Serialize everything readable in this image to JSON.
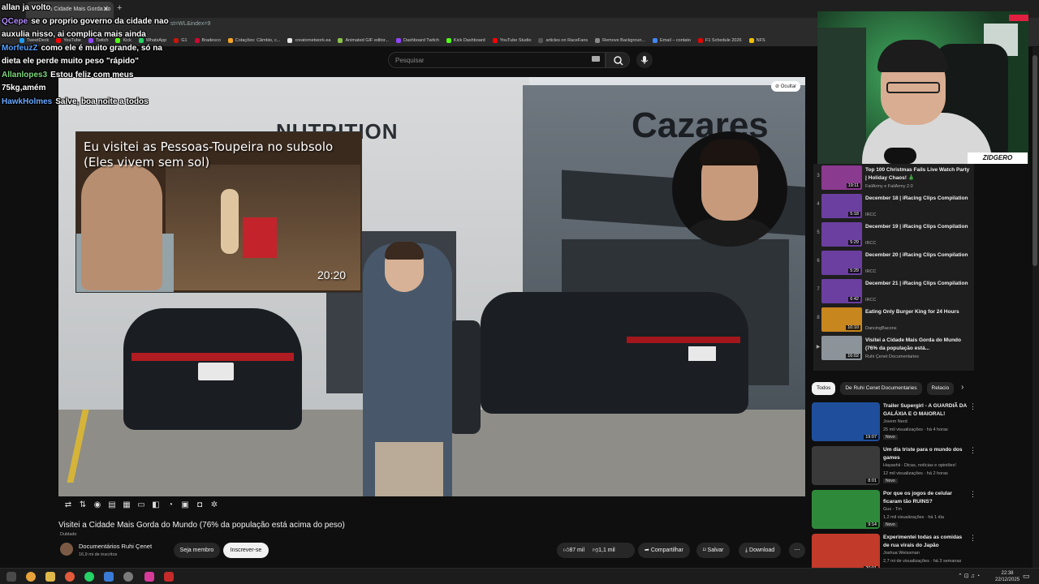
{
  "browser": {
    "tab_title": "Visitei a Cidade Mais Gorda do",
    "url": "st=WL&index=9",
    "bookmarks": [
      {
        "label": "TweetDeck",
        "color": "#1d9bf0"
      },
      {
        "label": "YouTube",
        "color": "#ff0000"
      },
      {
        "label": "Twitch",
        "color": "#9146ff"
      },
      {
        "label": "Kick",
        "color": "#53fc18"
      },
      {
        "label": "WhatsApp",
        "color": "#25d366"
      },
      {
        "label": "G1",
        "color": "#c4170c"
      },
      {
        "label": "Bradesco",
        "color": "#cc092f"
      },
      {
        "label": "Cotações: Câmbio, c...",
        "color": "#f5a623"
      },
      {
        "label": "creatornetwork.ea",
        "color": "#e8e8e8"
      },
      {
        "label": "Animated GIF editor...",
        "color": "#8bc34a"
      },
      {
        "label": "Dashboard Twitch",
        "color": "#9146ff"
      },
      {
        "label": "Kick Dashboard",
        "color": "#53fc18"
      },
      {
        "label": "YouTube Studio",
        "color": "#ff0000"
      },
      {
        "label": "articles on RaceFans",
        "color": "#555"
      },
      {
        "label": "Remove Backgroun...",
        "color": "#888"
      },
      {
        "label": "Email – contato",
        "color": "#4285f4"
      },
      {
        "label": "F1 Schedule 2026",
        "color": "#e10600"
      },
      {
        "label": "NFS",
        "color": "#f0c000"
      }
    ]
  },
  "header": {
    "search_placeholder": "Pesquisar"
  },
  "video": {
    "sign_nutrition": "NUTRITION",
    "sign_store": "Cazares",
    "hide_label": "Ocultar",
    "overlay_thumb": {
      "title": "Eu visitei as Pessoas-Toupeira no subsolo (Eles vivem sem sol)",
      "duration": "20:20"
    },
    "title": "Visitei a Cidade Mais Gorda do Mundo (76% da população está acima do peso)",
    "dubbed": "Dublado",
    "channel": "Documentários Ruhi Çenet",
    "subscribers": "16,9 mi de inscritos",
    "member_label": "Seja membro",
    "subscribe_label": "Inscrever-se",
    "likes": "87 mil",
    "dislikes": "1,1 mil",
    "share_label": "Compartilhar",
    "save_label": "Salvar",
    "download_label": "Download",
    "control_icons": [
      "loop-icon",
      "sort-icon",
      "audio-icon",
      "captions-icon",
      "chapters-icon",
      "theater-icon",
      "miniplayer-icon",
      "speed-icon",
      "transcript-icon",
      "screenshot-icon",
      "settings-icon"
    ]
  },
  "chat": [
    {
      "user": "allan ja volto",
      "color": "#ffffff",
      "message": ""
    },
    {
      "user": "QCepe",
      "color": "#b48cff",
      "message": "se o proprio governo da cidade nao auxulia nisso, ai complica mais ainda"
    },
    {
      "user": "MorfeuzZ",
      "color": "#5aa0ff",
      "message": "como ele é muito grande, só na dieta ele perde muito peso \"rápido\""
    },
    {
      "user": "Allanlopes3",
      "color": "#7dd87d",
      "message": "Estou feliz com meus 75kg,amém"
    },
    {
      "user": "HawkHolmes",
      "color": "#6aa8ff",
      "message": "Salve, boa noite a todos"
    }
  ],
  "webcam": {
    "logo": "ZIDGERO"
  },
  "playlist": [
    {
      "index": "3",
      "title": "Top 100 Christmas Fails Live Watch Party | Holiday Chaos! 🎄",
      "channel": "FailArmy e FailArmy 2.0",
      "duration": "19:11",
      "color": "#8a3a8f"
    },
    {
      "index": "4",
      "title": "December 18 | iRacing Clips Compilation",
      "channel": "IRCC",
      "duration": "5:18",
      "color": "#6b3fa0"
    },
    {
      "index": "5",
      "title": "December 19 | iRacing Clips Compilation",
      "channel": "IRCC",
      "duration": "5:29",
      "color": "#6b3fa0"
    },
    {
      "index": "6",
      "title": "December 20 | iRacing Clips Compilation",
      "channel": "IRCC",
      "duration": "5:29",
      "color": "#6b3fa0"
    },
    {
      "index": "7",
      "title": "December 21 | iRacing Clips Compilation",
      "channel": "IRCC",
      "duration": "6:42",
      "color": "#6b3fa0"
    },
    {
      "index": "8",
      "title": "Eating Only Burger King for 24 Hours",
      "channel": "DancingBacons",
      "duration": "10:10",
      "color": "#c8861e"
    },
    {
      "index": "▶",
      "title": "Visitei a Cidade Mais Gorda do Mundo (76% da população está...",
      "channel": "Ruhi Çenet Documentaries",
      "duration": "16:02",
      "color": "#8c949a"
    }
  ],
  "chips": [
    {
      "label": "Todos",
      "active": true
    },
    {
      "label": "De Ruhi Cenet Documentaries",
      "active": false
    },
    {
      "label": "Relacio",
      "active": false
    }
  ],
  "recommendations": [
    {
      "title": "Trailer Supergirl - A GUARDIÃ DA GALÁXIA E O MAIORAL!",
      "channel": "Jovem Nerd",
      "meta": "25 mil visualizações · há 4 horas",
      "badge": "Novo",
      "duration": "19:07",
      "color": "#1f4f9c"
    },
    {
      "title": "Um dia triste para o mundo dos games",
      "channel": "Hayashii - Dicas, notícias e opiniões!",
      "meta": "12 mil visualizações · há 2 horas",
      "badge": "Novo",
      "duration": "8:01",
      "color": "#3a3a3a"
    },
    {
      "title": "Por que os jogos de celular ficaram tão RUINS?",
      "channel": "Gus - Tm",
      "meta": "1,2 mil visualizações · há 1 dia",
      "badge": "Novo",
      "duration": "9:14",
      "color": "#2e8a3a"
    },
    {
      "title": "Experimentei todas as comidas de rua virais do Japão",
      "channel": "Joshua Weissman",
      "meta": "2,7 mi de visualizações · há 3 semanas",
      "badge": "",
      "duration": "20:01",
      "color": "#c23a2a"
    }
  ],
  "taskbar": {
    "time": "22:38",
    "date": "22/12/2025"
  }
}
